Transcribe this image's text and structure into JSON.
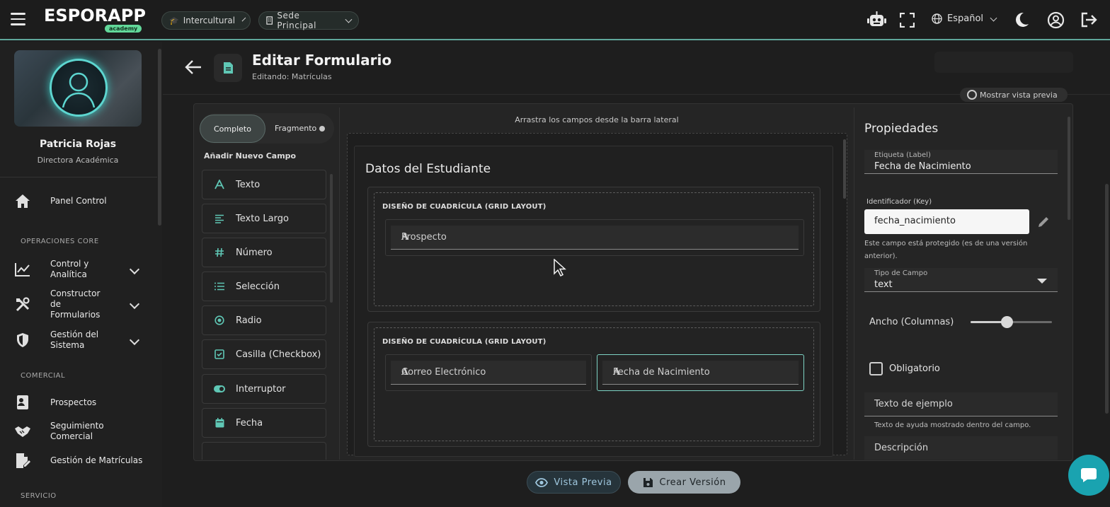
{
  "topbar": {
    "logo": "ESPORAPP",
    "logo_badge": "academy",
    "school_chip": "Intercultural",
    "campus_chip": "Sede Principal",
    "language": "Español"
  },
  "sidebar": {
    "user_name": "Patricia Rojas",
    "user_role": "Directora Académica",
    "items": [
      {
        "label": "Panel Control"
      },
      {
        "label": "Control y\nAnalítica"
      },
      {
        "label": "Constructor\nde\nFormularios"
      },
      {
        "label": "Gestión del\nSistema"
      },
      {
        "label": "Prospectos"
      },
      {
        "label": "Seguimiento\nComercial"
      },
      {
        "label": "Gestión de Matrículas"
      }
    ],
    "sections": [
      "OPERACIONES CORE",
      "COMERCIAL",
      "SERVICIO"
    ]
  },
  "header": {
    "title": "Editar Formulario",
    "subtitle": "Editando: Matrículas",
    "preview_toggle": "Mostrar vista previa"
  },
  "palette": {
    "mode_active": "Completo",
    "mode_other": "Fragmento",
    "title": "Añadir Nuevo Campo",
    "items": [
      {
        "label": "Texto",
        "icon": "text-icon"
      },
      {
        "label": "Texto Largo",
        "icon": "long-text-icon"
      },
      {
        "label": "Número",
        "icon": "hash-icon"
      },
      {
        "label": "Selección",
        "icon": "list-icon"
      },
      {
        "label": "Radio",
        "icon": "radio-icon"
      },
      {
        "label": "Casilla (Checkbox)",
        "icon": "checkbox-icon"
      },
      {
        "label": "Interruptor",
        "icon": "toggle-icon"
      },
      {
        "label": "Fecha",
        "icon": "calendar-icon"
      }
    ]
  },
  "canvas": {
    "hint": "Arrastra los campos desde la barra lateral",
    "section_title": "Datos del Estudiante",
    "grids": [
      {
        "label": "DISEÑO DE CUADRÍCULA (GRID LAYOUT)",
        "fields": [
          "Prospecto"
        ]
      },
      {
        "label": "DISEÑO DE CUADRÍCULA (GRID LAYOUT)",
        "fields": [
          "Correo Electrónico",
          "Fecha de Nacimiento"
        ]
      }
    ]
  },
  "properties": {
    "title": "Propiedades",
    "label_caption": "Etiqueta (Label)",
    "label_value": "Fecha de Nacimiento",
    "key_caption": "Identificador (Key)",
    "key_value": "fecha_nacimiento",
    "key_help": "Este campo está protegido (es de una versión anterior).",
    "type_caption": "Tipo de Campo",
    "type_value": "text",
    "width_label": "Ancho (Columnas)",
    "width_value": 0.45,
    "required_label": "Obligatorio",
    "placeholder_field": "Texto de ejemplo",
    "placeholder_help": "Texto de ayuda mostrado dentro del campo.",
    "description_field": "Descripción"
  },
  "actions": {
    "preview": "Vista Previa",
    "create_version": "Crear Versión"
  },
  "colors": {
    "accent": "#5fc7b5",
    "selected_border": "#7dd3c4",
    "fab": "#1aa3b0"
  }
}
